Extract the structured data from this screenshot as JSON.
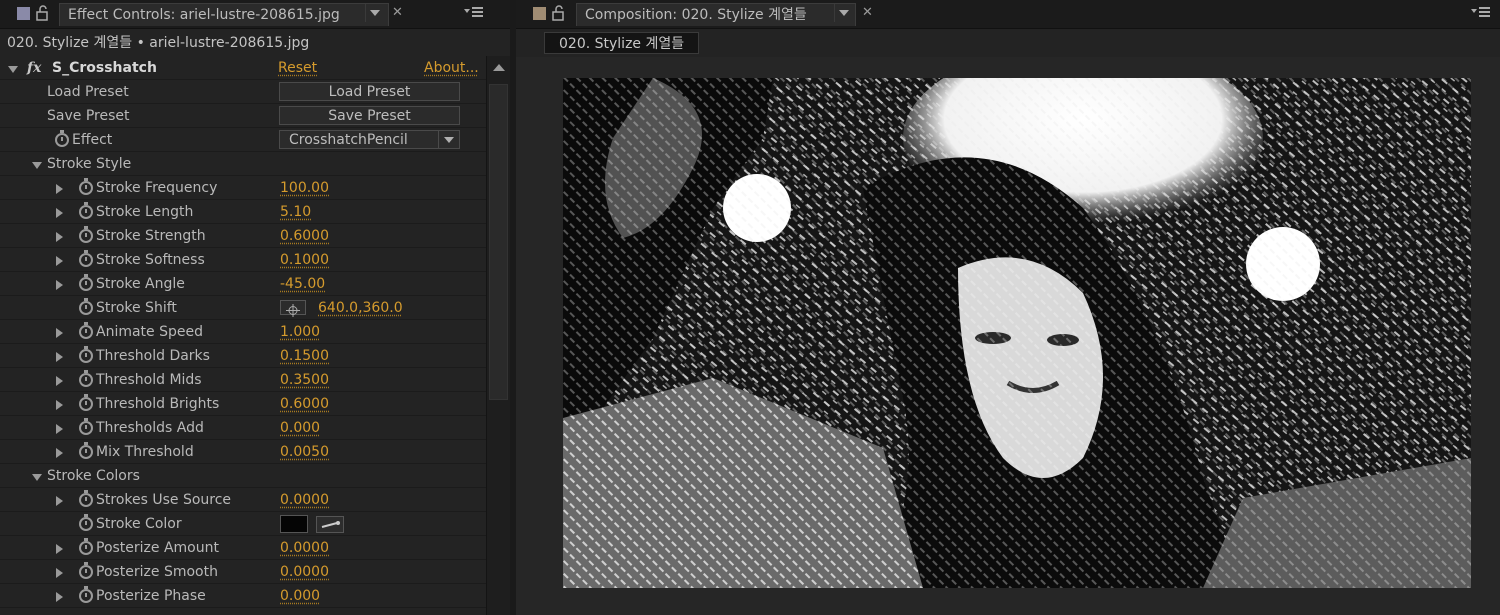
{
  "effect_controls": {
    "tab_title": "Effect Controls: ariel-lustre-208615.jpg",
    "subtitle": "020. Stylize 계열들 • ariel-lustre-208615.jpg",
    "effect_name": "S_Crosshatch",
    "reset_label": "Reset",
    "about_label": "About...",
    "load_preset_label": "Load Preset",
    "load_preset_button": "Load Preset",
    "save_preset_label": "Save Preset",
    "save_preset_button": "Save Preset",
    "effect_label": "Effect",
    "effect_value": "CrosshatchPencil",
    "stroke_style_label": "Stroke Style",
    "stroke_colors_label": "Stroke Colors",
    "properties": [
      {
        "label": "Stroke Frequency",
        "value": "100.00"
      },
      {
        "label": "Stroke Length",
        "value": "5.10"
      },
      {
        "label": "Stroke Strength",
        "value": "0.6000"
      },
      {
        "label": "Stroke Softness",
        "value": "0.1000"
      },
      {
        "label": "Stroke Angle",
        "value": "-45.00"
      },
      {
        "label": "Stroke Shift",
        "value": "640.0,360.0"
      },
      {
        "label": "Animate Speed",
        "value": "1.000"
      },
      {
        "label": "Threshold Darks",
        "value": "0.1500"
      },
      {
        "label": "Threshold Mids",
        "value": "0.3500"
      },
      {
        "label": "Threshold Brights",
        "value": "0.6000"
      },
      {
        "label": "Thresholds Add",
        "value": "0.000"
      },
      {
        "label": "Mix Threshold",
        "value": "0.0050"
      }
    ],
    "color_properties": [
      {
        "label": "Strokes Use Source",
        "value": "0.0000"
      },
      {
        "label": "Stroke Color",
        "value": ""
      },
      {
        "label": "Posterize Amount",
        "value": "0.0000"
      },
      {
        "label": "Posterize Smooth",
        "value": "0.0000"
      },
      {
        "label": "Posterize Phase",
        "value": "0.000"
      }
    ],
    "stroke_color_hex": "#050505"
  },
  "composition": {
    "tab_title": "Composition: 020. Stylize 계열들",
    "comp_name": "020. Stylize 계열들"
  },
  "colors": {
    "value_orange": "#d59b2d",
    "panel_bg": "#232323"
  }
}
